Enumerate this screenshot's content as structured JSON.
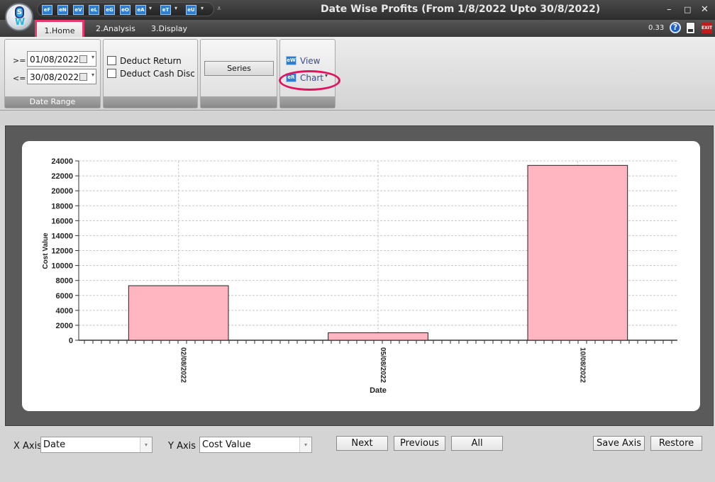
{
  "window": {
    "title": "Date Wise Profits (From 1/8/2022 Upto 30/8/2022)",
    "minimize": "–",
    "maximize": "□",
    "close": "✕"
  },
  "qat": {
    "buttons": [
      "eF",
      "eN",
      "eV",
      "eL",
      "eG",
      "eO",
      "eA",
      "eT",
      "eU"
    ]
  },
  "tabs": [
    {
      "label": "1.Home"
    },
    {
      "label": "2.Analysis"
    },
    {
      "label": "3.Display"
    }
  ],
  "version": "0.33",
  "icons": {
    "logo": "app-logo-icon",
    "help": "help-icon",
    "doc": "document-icon",
    "exit": "exit-icon",
    "calendar": "calendar-icon"
  },
  "colors": {
    "highlight": "#e0145e",
    "bar_fill": "#ffb6c1",
    "bar_stroke": "#222222"
  },
  "ribbon": {
    "date_range": {
      "ge_label": ">=",
      "ge_value": "01/08/2022",
      "le_label": "<=",
      "le_value": "30/08/2022",
      "footer": "Date Range"
    },
    "deduct": {
      "return_label": "Deduct Return",
      "cash_disc_label": "Deduct Cash Disc",
      "return_checked": false,
      "cash_disc_checked": false
    },
    "series": {
      "label": "Series"
    },
    "view_group": {
      "view_label": "View",
      "view_icon": "eW",
      "chart_label": "Chart",
      "chart_icon": "eR"
    }
  },
  "chart_data": {
    "type": "bar",
    "categories": [
      "02/08/2022",
      "05/08/2022",
      "10/08/2022"
    ],
    "values": [
      7300,
      1000,
      23400
    ],
    "xlabel": "Date",
    "ylabel": "Cost Value",
    "ylim": [
      0,
      24000
    ],
    "yticks": [
      0,
      2000,
      4000,
      6000,
      8000,
      10000,
      12000,
      14000,
      16000,
      18000,
      20000,
      22000,
      24000
    ],
    "grid": true
  },
  "bottom": {
    "x_axis_label": "X Axis",
    "x_axis_value": "Date",
    "y_axis_label": "Y Axis",
    "y_axis_value": "Cost Value",
    "next": "Next",
    "previous": "Previous",
    "all": "All",
    "save_axis": "Save Axis",
    "restore": "Restore"
  }
}
